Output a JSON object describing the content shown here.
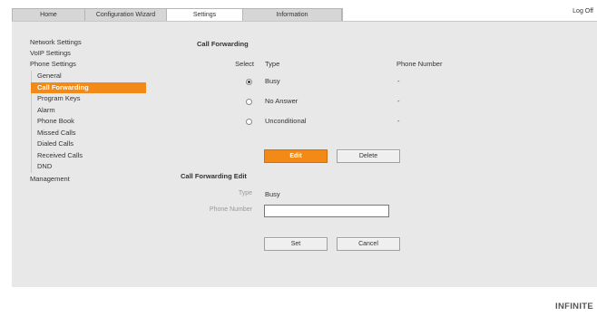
{
  "tabs": [
    {
      "label": "Home",
      "active": false
    },
    {
      "label": "Configuration Wizard",
      "active": false
    },
    {
      "label": "Settings",
      "active": true
    },
    {
      "label": "Information",
      "active": false
    }
  ],
  "logoff_label": "Log Off",
  "sidebar": {
    "items_top": [
      "Network Settings",
      "VoIP Settings",
      "Phone Settings"
    ],
    "sub_items": [
      "General",
      "Call Forwarding",
      "Program Keys",
      "Alarm",
      "Phone Book",
      "Missed Calls",
      "Dialed Calls",
      "Received Calls",
      "DND"
    ],
    "active_sub": "Call Forwarding",
    "items_bottom": [
      "Management"
    ]
  },
  "call_forwarding": {
    "title": "Call Forwarding",
    "col_select": "Select",
    "col_type": "Type",
    "col_phone": "Phone Number",
    "rows": [
      {
        "type": "Busy",
        "phone": "-",
        "selected": true
      },
      {
        "type": "No Answer",
        "phone": "-",
        "selected": false
      },
      {
        "type": "Unconditional",
        "phone": "-",
        "selected": false
      }
    ],
    "edit_label": "Edit",
    "delete_label": "Delete"
  },
  "edit_section": {
    "title": "Call Forwarding Edit",
    "type_label": "Type",
    "type_value": "Busy",
    "phone_label": "Phone Number",
    "phone_value": "",
    "set_label": "Set",
    "cancel_label": "Cancel"
  },
  "brand": "INFINITE",
  "colors": {
    "accent": "#f38a17",
    "panel": "#e8e8e8"
  }
}
